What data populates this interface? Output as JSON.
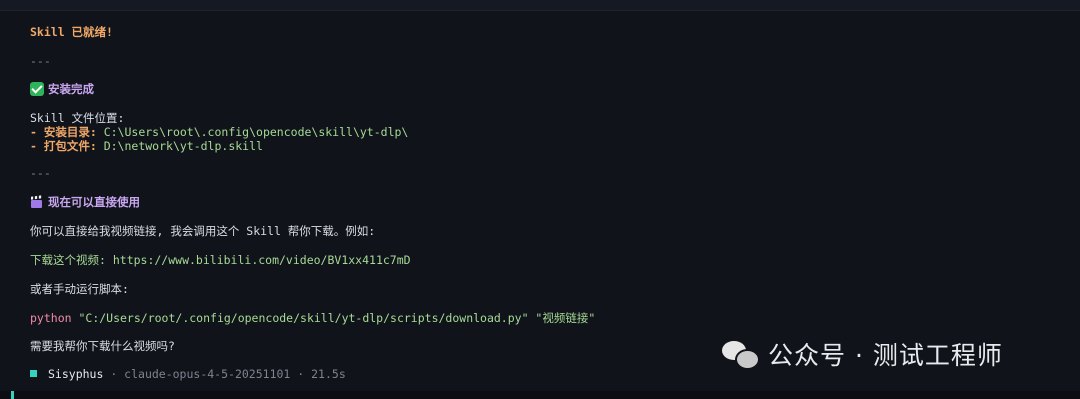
{
  "header": {
    "ready": "Skill 已就绪!"
  },
  "divider_1": "---",
  "install": {
    "title": "安装完成",
    "location_label": "Skill 文件位置:",
    "dir_label": "- 安装目录:",
    "dir_value": " C:\\Users\\root\\.config\\opencode\\skill\\yt-dlp\\",
    "pkg_label": "- 打包文件:",
    "pkg_value": " D:\\network\\yt-dlp.skill"
  },
  "divider_2": "---",
  "usage": {
    "title": "现在可以直接使用",
    "intro": "你可以直接给我视频链接, 我会调用这个 Skill 帮你下载。例如:",
    "example": "下载这个视频: https://www.bilibili.com/video/BV1xx411c7mD",
    "manual": "或者手动运行脚本:",
    "cmd": "python",
    "cmd_path": " \"C:/Users/root/.config/opencode/skill/yt-dlp/scripts/download.py\" \"视频链接\"",
    "question": "需要我帮你下载什么视频吗?"
  },
  "status": {
    "agent": "Sisyphus",
    "sep1": " · ",
    "model": "claude-opus-4-5-20251101",
    "sep2": " · ",
    "time": "21.5s"
  },
  "watermark": {
    "text": "公众号 · 测试工程师"
  },
  "icons": {
    "install_title": "check-box-icon",
    "usage_title": "clapperboard-icon",
    "status": "status-square-icon",
    "watermark": "wechat-icon"
  },
  "colors": {
    "background": "#10131a",
    "accent": "#35d2c0",
    "orange": "#f0a868",
    "purple": "#c9a6f0",
    "green": "#a6da95",
    "pink": "#f28aa6"
  }
}
